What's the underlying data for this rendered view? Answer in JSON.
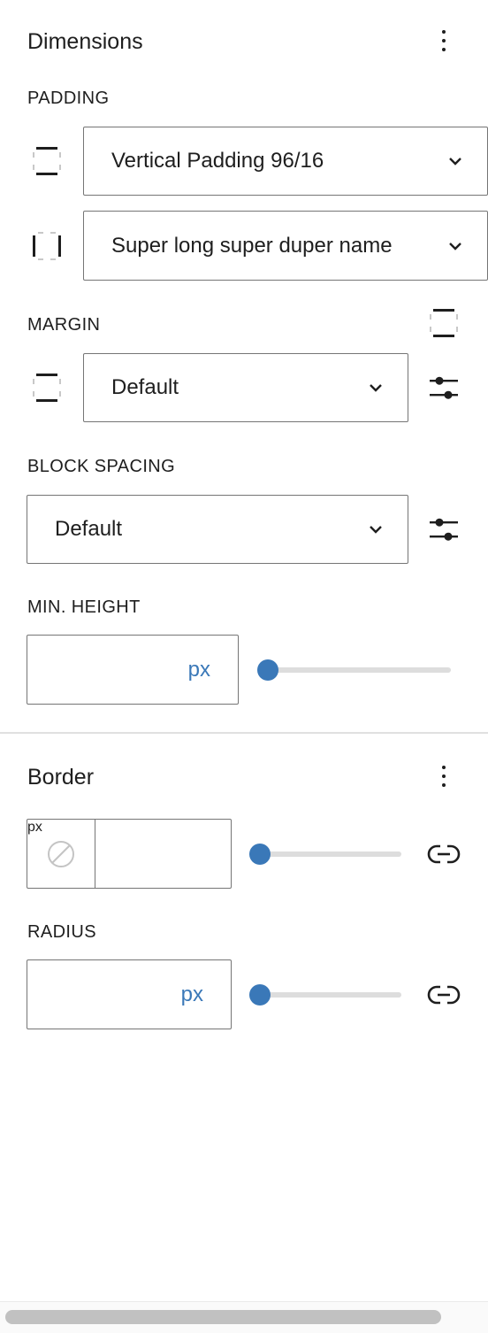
{
  "dimensions": {
    "title": "Dimensions",
    "options_icon": "more-vertical-icon",
    "padding": {
      "label": "PADDING",
      "rows": [
        {
          "icon": "padding-vertical-icon",
          "value": "Vertical Padding 96/16"
        },
        {
          "icon": "padding-horizontal-icon",
          "value": "Super long super duper name"
        }
      ]
    },
    "margin": {
      "label": "MARGIN",
      "header_icon": "margin-sides-icon",
      "row_icon": "margin-vertical-icon",
      "value": "Default",
      "custom_icon": "settings-sliders-icon"
    },
    "block_spacing": {
      "label": "BLOCK SPACING",
      "value": "Default",
      "custom_icon": "settings-sliders-icon"
    },
    "min_height": {
      "label": "MIN. HEIGHT",
      "value": "",
      "unit": "px",
      "slider_fraction": 0
    }
  },
  "border": {
    "title": "Border",
    "options_icon": "more-vertical-icon",
    "width": {
      "color_icon": "no-color-icon",
      "value": "",
      "unit": "px",
      "slider_fraction": 0,
      "link_icon": "link-icon"
    },
    "radius": {
      "label": "RADIUS",
      "value": "",
      "unit": "px",
      "slider_fraction": 0,
      "link_icon": "link-icon"
    }
  },
  "colors": {
    "accent": "#3a78b8",
    "text": "#1e1e1e",
    "border": "#757575",
    "track": "#dddddd",
    "divider": "#e0e0e0"
  }
}
